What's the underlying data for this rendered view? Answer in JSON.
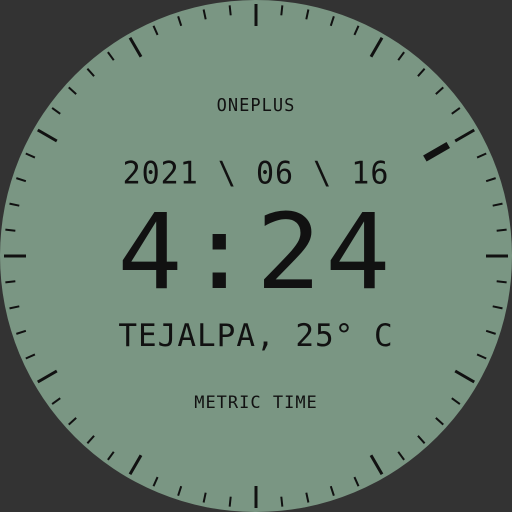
{
  "watch": {
    "brand": "ONEPLUS",
    "date": "2021 \\ 06 \\ 16",
    "time": "4:24",
    "weather": "TEJALPA, 25° C",
    "footer": "METRIC TIME"
  },
  "colors": {
    "face": "#7a9683",
    "background": "#333333",
    "ink": "#111111"
  }
}
